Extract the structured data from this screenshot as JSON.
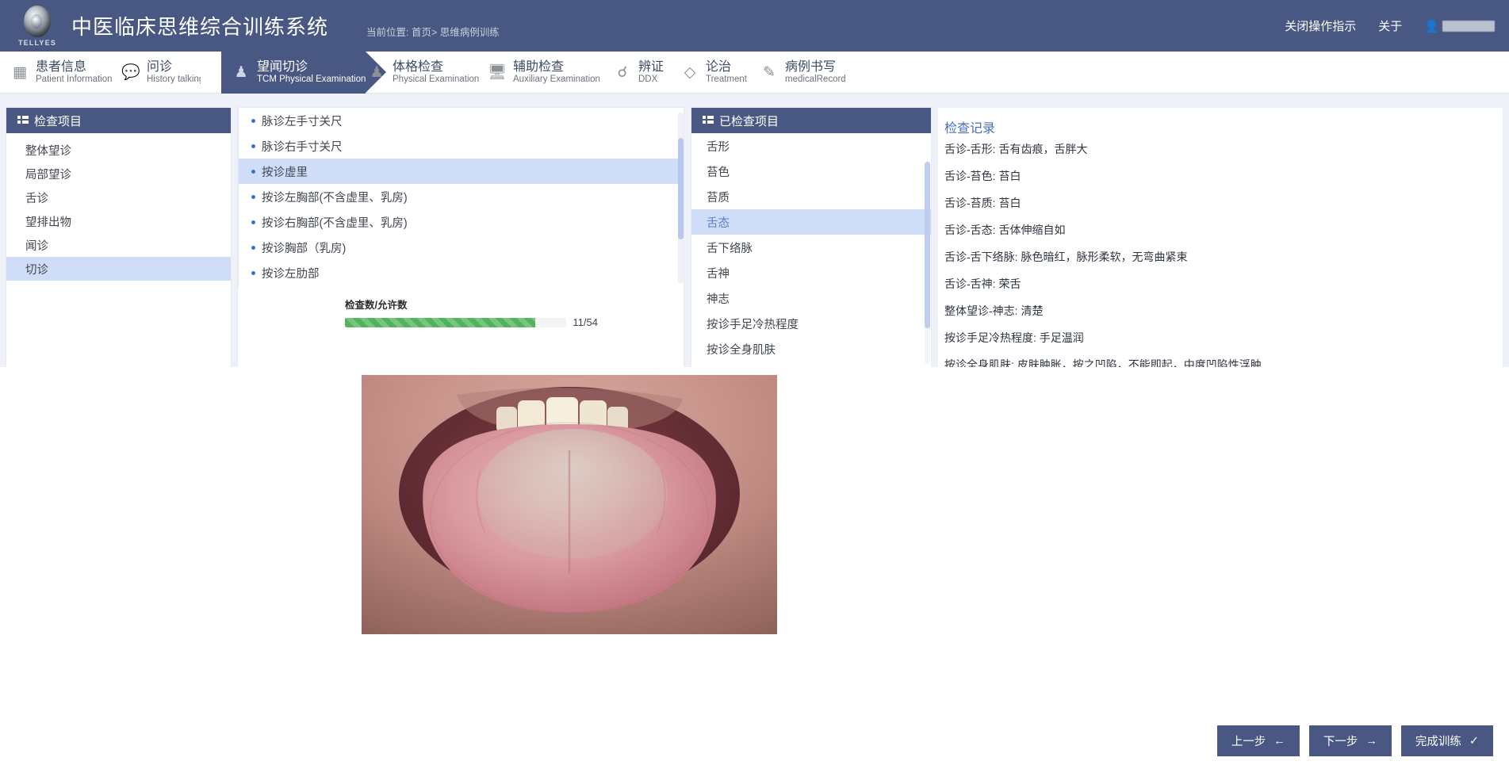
{
  "header": {
    "logo_text": "TELLYES",
    "app_title": "中医临床思维综合训练系统",
    "breadcrumb": "当前位置: 首页> 思维病例训练",
    "close_guide_label": "关闭操作指示",
    "about_label": "关于",
    "user_icon": "user-icon",
    "accent_color": "#485882"
  },
  "steps": [
    {
      "cn": "患者信息",
      "en": "Patient Information",
      "icon": "id-card-icon",
      "glyph": "▤"
    },
    {
      "cn": "问诊",
      "en": "History talking",
      "icon": "chat-bubble-icon",
      "glyph": "▭"
    },
    {
      "cn": "望闻切诊",
      "en": "TCM Physical Examination",
      "icon": "person-icon",
      "glyph": "♟"
    },
    {
      "cn": "体格检查",
      "en": "Physical Examination",
      "icon": "person-icon",
      "glyph": "♟"
    },
    {
      "cn": "辅助检查",
      "en": "Auxiliary Examination",
      "icon": "monitor-icon",
      "glyph": "🖵"
    },
    {
      "cn": "辨证",
      "en": "DDX",
      "icon": "stethoscope-icon",
      "glyph": "☊"
    },
    {
      "cn": "论治",
      "en": "Treatment",
      "icon": "capsule-icon",
      "glyph": "◇"
    },
    {
      "cn": "病例书写",
      "en": "medicalRecord",
      "icon": "document-pen-icon",
      "glyph": "▤"
    }
  ],
  "active_step_index": 2,
  "left_panel": {
    "title": "检查项目",
    "icon": "grid-icon",
    "items": [
      {
        "label": "整体望诊",
        "selected": false
      },
      {
        "label": "局部望诊",
        "selected": false
      },
      {
        "label": "舌诊",
        "selected": false
      },
      {
        "label": "望排出物",
        "selected": false
      },
      {
        "label": "闻诊",
        "selected": false
      },
      {
        "label": "切诊",
        "selected": true
      }
    ]
  },
  "middle_panel": {
    "items": [
      {
        "label": "脉诊左手寸关尺",
        "selected": false
      },
      {
        "label": "脉诊右手寸关尺",
        "selected": false
      },
      {
        "label": "按诊虚里",
        "selected": true
      },
      {
        "label": "按诊左胸部(不含虚里、乳房)",
        "selected": false
      },
      {
        "label": "按诊右胸部(不含虚里、乳房)",
        "selected": false
      },
      {
        "label": "按诊胸部（乳房)",
        "selected": false
      },
      {
        "label": "按诊左肋部",
        "selected": false
      }
    ],
    "progress_label": "检查数/允许数",
    "progress_text": "11/54",
    "progress_done": 11,
    "progress_total": 54,
    "progress_color": "#53b35a"
  },
  "right_panel": {
    "title": "已检查项目",
    "icon": "grid-icon",
    "items": [
      {
        "label": "舌形",
        "selected": false
      },
      {
        "label": "苔色",
        "selected": false
      },
      {
        "label": "苔质",
        "selected": false
      },
      {
        "label": "舌态",
        "selected": true
      },
      {
        "label": "舌下络脉",
        "selected": false
      },
      {
        "label": "舌神",
        "selected": false
      },
      {
        "label": "神志",
        "selected": false
      },
      {
        "label": "按诊手足冷热程度",
        "selected": false
      },
      {
        "label": "按诊全身肌肤",
        "selected": false
      }
    ]
  },
  "record": {
    "title": "检查记录",
    "lines": [
      "舌诊-舌形: 舌有齿痕，舌胖大",
      "舌诊-苔色: 苔白",
      "舌诊-苔质: 苔白",
      "舌诊-舌态: 舌体伸缩自如",
      "舌诊-舌下络脉: 脉色暗红，脉形柔软，无弯曲紧束",
      "舌诊-舌神: 荣舌",
      "整体望诊-神志: 清楚",
      "按诊手足冷热程度: 手足温润",
      "按诊全身肌肤: 皮肤肿胀，按之凹陷，不能即起，中度凹陷性浮肿"
    ]
  },
  "main_image": {
    "name": "tongue-examination-photo",
    "alt": "舌诊照片"
  },
  "footer": {
    "prev_label": "上一步",
    "prev_icon": "arrow-left-icon",
    "next_label": "下一步",
    "next_icon": "arrow-right-icon",
    "finish_label": "完成训练",
    "finish_icon": "check-icon"
  }
}
